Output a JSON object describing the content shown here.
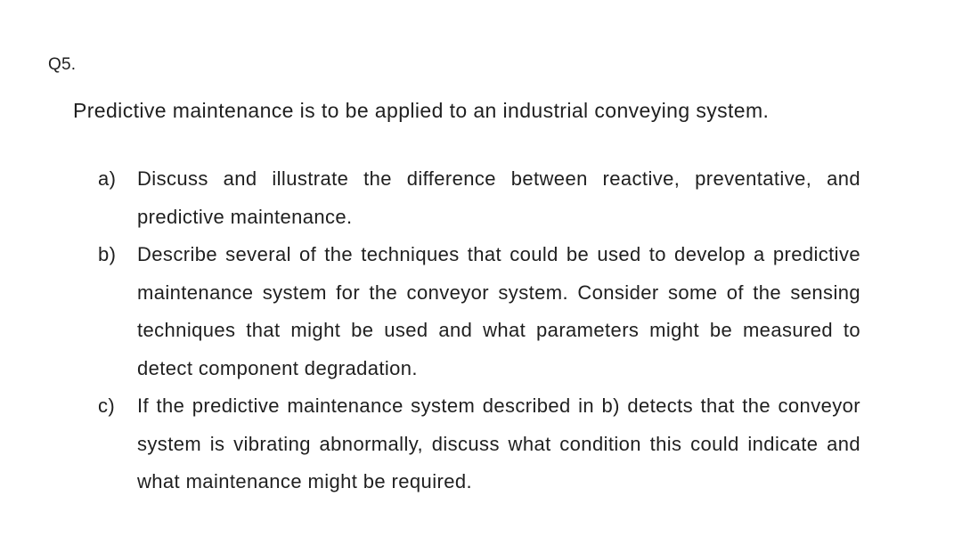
{
  "question": {
    "number": "Q5.",
    "intro": "Predictive maintenance is to be applied to an industrial conveying system.",
    "parts": [
      {
        "label": "a)",
        "text": "Discuss and illustrate the difference between reactive, preventative, and predictive maintenance."
      },
      {
        "label": "b)",
        "text": "Describe several of the techniques that could be used to develop a predictive maintenance system for the conveyor system. Consider some of the sensing techniques that might be used and what parameters might be measured to detect component degradation."
      },
      {
        "label": "c)",
        "text": "If the predictive maintenance system described in b) detects that the conveyor system is vibrating abnormally, discuss what condition this could indicate and what maintenance might be required."
      }
    ]
  }
}
